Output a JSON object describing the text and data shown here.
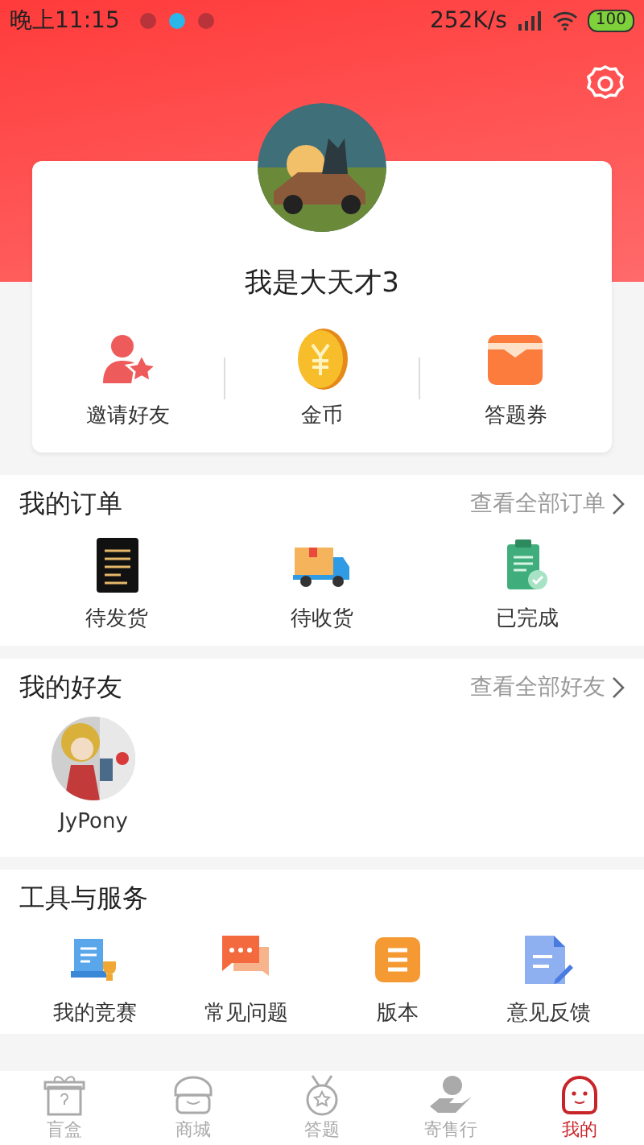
{
  "status_bar": {
    "time": "晚上11:15",
    "speed": "252K/s",
    "battery": "100"
  },
  "profile": {
    "name": "我是大天才3"
  },
  "stats": [
    {
      "kind": "invite",
      "label": "邀请好友"
    },
    {
      "kind": "coin",
      "label": "金币"
    },
    {
      "kind": "ticket",
      "label": "答题券"
    }
  ],
  "orders": {
    "title": "我的订单",
    "link": "查看全部订单",
    "items": [
      {
        "kind": "ship",
        "label": "待发货"
      },
      {
        "kind": "truck",
        "label": "待收货"
      },
      {
        "kind": "done",
        "label": "已完成"
      }
    ]
  },
  "friends": {
    "title": "我的好友",
    "link": "查看全部好友",
    "items": [
      {
        "name": "JyPony"
      }
    ]
  },
  "tools": {
    "title": "工具与服务",
    "items": [
      {
        "kind": "contest",
        "label": "我的竞赛"
      },
      {
        "kind": "faq",
        "label": "常见问题"
      },
      {
        "kind": "version",
        "label": "版本"
      },
      {
        "kind": "feedback",
        "label": "意见反馈"
      }
    ]
  },
  "tab_bar": [
    {
      "kind": "box",
      "label": "盲盒",
      "selected": false
    },
    {
      "kind": "shop",
      "label": "商城",
      "selected": false
    },
    {
      "kind": "quiz",
      "label": "答题",
      "selected": false
    },
    {
      "kind": "consign",
      "label": "寄售行",
      "selected": false
    },
    {
      "kind": "me",
      "label": "我的",
      "selected": true
    }
  ]
}
